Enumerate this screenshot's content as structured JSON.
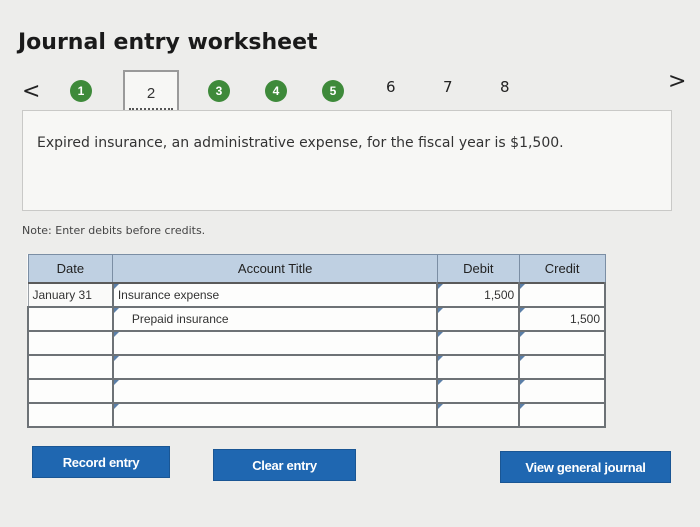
{
  "header": {
    "title": "Journal entry worksheet"
  },
  "nav": {
    "prev_label": "<",
    "next_label": ">",
    "steps": [
      {
        "label": "1",
        "state": "completed"
      },
      {
        "label": "2",
        "state": "current"
      },
      {
        "label": "3",
        "state": "completed"
      },
      {
        "label": "4",
        "state": "completed"
      },
      {
        "label": "5",
        "state": "completed"
      },
      {
        "label": "6",
        "state": "pending"
      },
      {
        "label": "7",
        "state": "pending"
      },
      {
        "label": "8",
        "state": "pending"
      }
    ]
  },
  "prompt": {
    "text": "Expired insurance, an administrative expense, for the fiscal year is $1,500."
  },
  "note": {
    "text": "Note: Enter debits before credits."
  },
  "table": {
    "headers": {
      "date": "Date",
      "account": "Account Title",
      "debit": "Debit",
      "credit": "Credit"
    },
    "rows": [
      {
        "date": "January 31",
        "account": "Insurance expense",
        "debit": "1,500",
        "credit": ""
      },
      {
        "date": "",
        "account": "Prepaid insurance",
        "debit": "",
        "credit": "1,500"
      },
      {
        "date": "",
        "account": "",
        "debit": "",
        "credit": ""
      },
      {
        "date": "",
        "account": "",
        "debit": "",
        "credit": ""
      },
      {
        "date": "",
        "account": "",
        "debit": "",
        "credit": ""
      },
      {
        "date": "",
        "account": "",
        "debit": "",
        "credit": ""
      }
    ]
  },
  "buttons": {
    "record": "Record entry",
    "clear": "Clear entry",
    "view": "View general journal"
  },
  "colors": {
    "step_completed": "#3e8a3a",
    "header_bg": "#bfd0e2",
    "button_bg": "#1f67b1",
    "page_bg": "#ededeb"
  }
}
